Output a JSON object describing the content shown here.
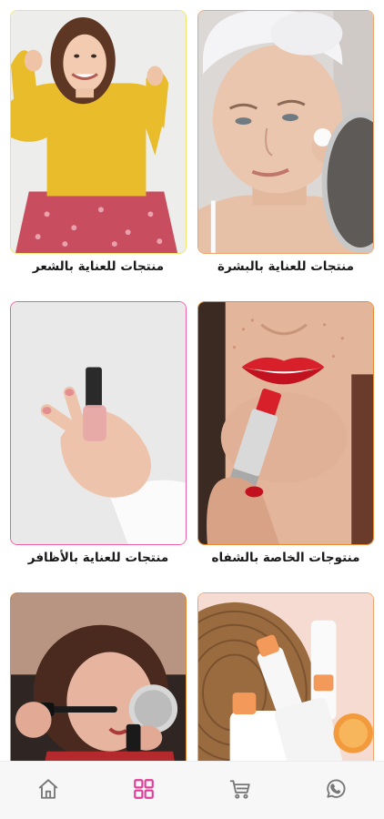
{
  "categories": [
    {
      "label": "منتجات للعناية بالبشرة",
      "border_color": "#f0a46a",
      "image": "woman-skincare-towel-photo"
    },
    {
      "label": "منتجات للعناية بالشعر",
      "border_color": "#f2e36b",
      "image": "woman-yellow-sweater-photo"
    },
    {
      "label": "منتوجات الخاصة بالشفاه",
      "border_color": "#e8892f",
      "image": "red-lipstick-photo"
    },
    {
      "label": "منتجات للعناية بالأظافر",
      "border_color": "#ec5fa8",
      "image": "nail-polish-photo"
    },
    {
      "label": "",
      "border_color": "#f0a46a",
      "image": "skincare-bottles-photo"
    },
    {
      "label": "",
      "border_color": "#e8892f",
      "image": "woman-mascara-photo"
    }
  ],
  "bottom_nav": {
    "items": [
      {
        "icon": "home-icon",
        "active": false
      },
      {
        "icon": "grid-icon",
        "active": true
      },
      {
        "icon": "cart-icon",
        "active": false
      },
      {
        "icon": "whatsapp-icon",
        "active": false
      }
    ],
    "active_color": "#e0409a",
    "inactive_color": "#777777"
  }
}
